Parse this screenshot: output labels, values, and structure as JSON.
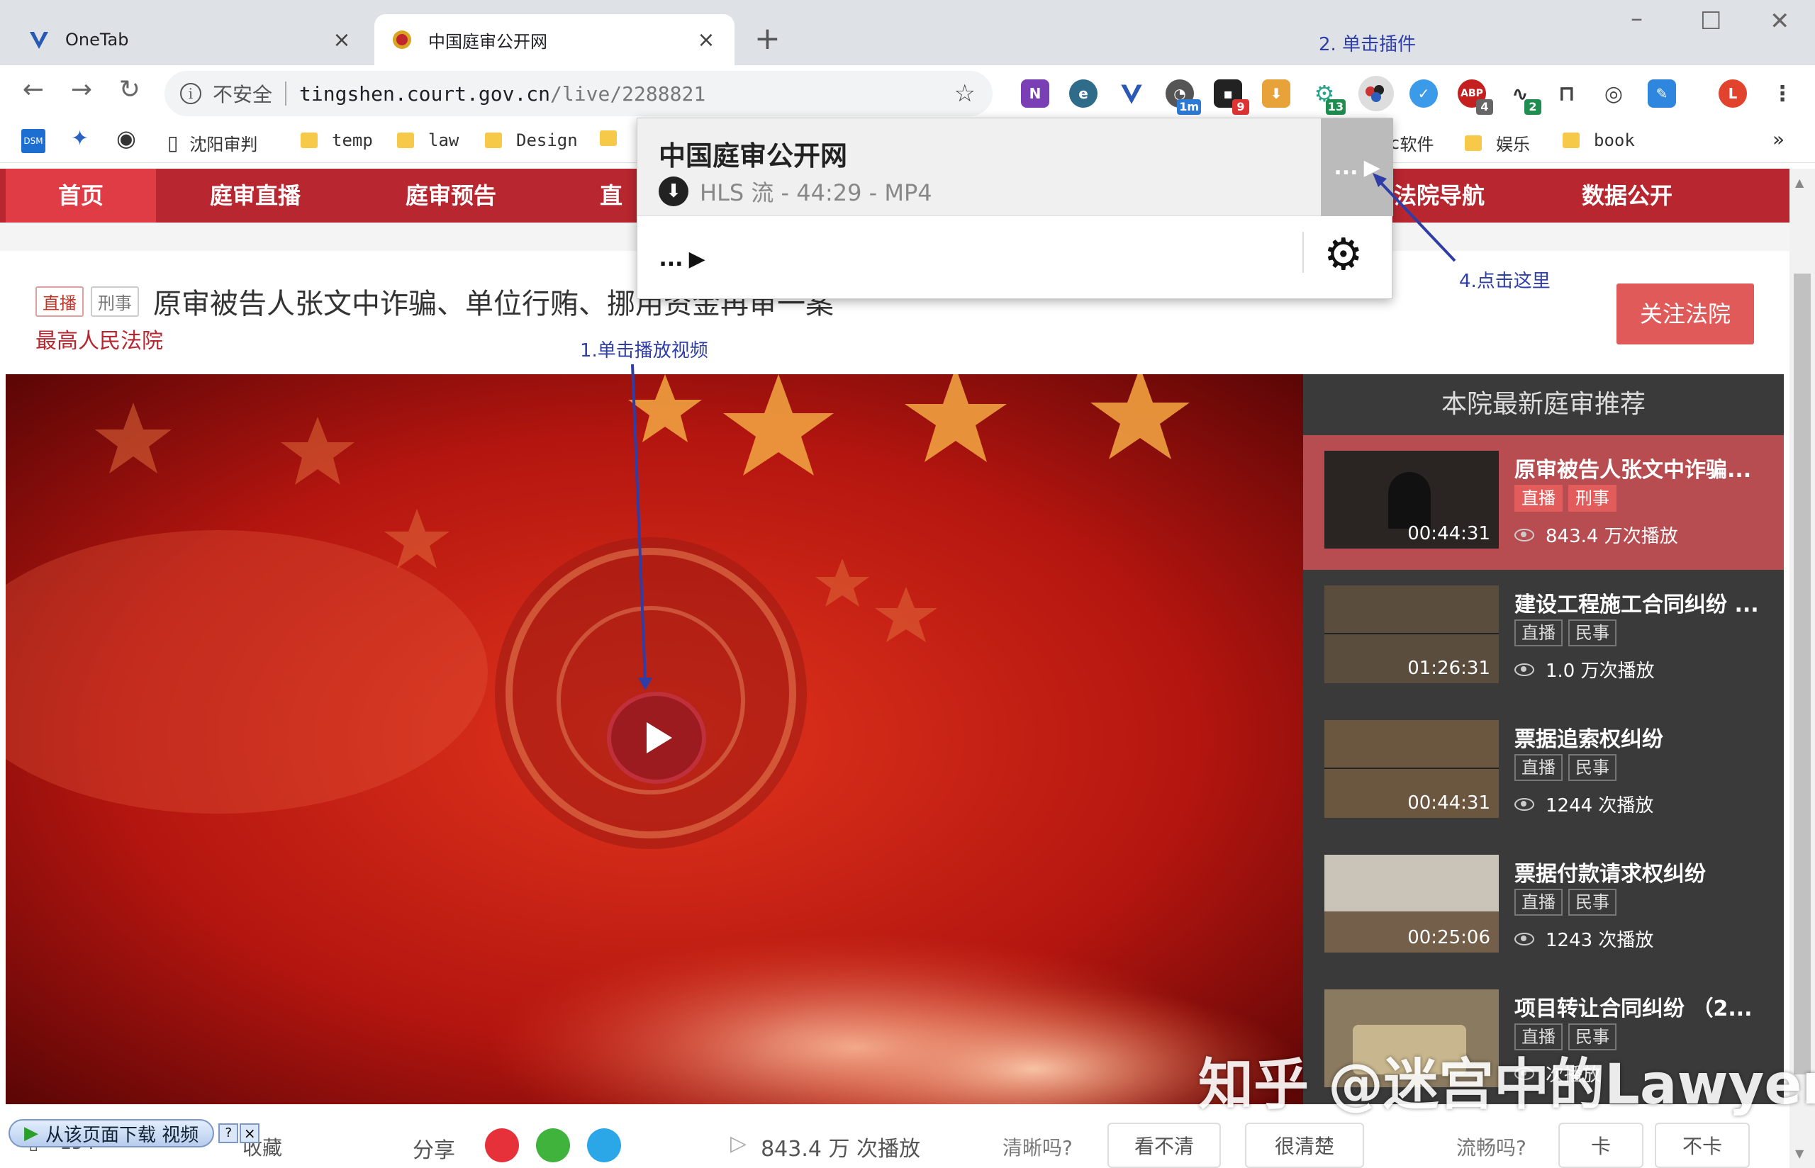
{
  "browser": {
    "tabs": [
      {
        "title": "OneTab",
        "icon": "onetab-icon"
      },
      {
        "title": "中国庭审公开网",
        "icon": "court-emblem-icon"
      }
    ],
    "url": {
      "security": "不安全",
      "host": "tingshen.court.gov.cn",
      "path": "/live/2288821"
    },
    "extensions": [
      {
        "name": "onenote-extension",
        "badge": ""
      },
      {
        "name": "extension-e",
        "badge": ""
      },
      {
        "name": "onetab-extension",
        "badge": ""
      },
      {
        "name": "extension-clock",
        "badge": "1m"
      },
      {
        "name": "extension-dark",
        "badge": "9"
      },
      {
        "name": "extension-download",
        "badge": ""
      },
      {
        "name": "extension-gear",
        "badge": "13"
      },
      {
        "name": "video-downloader-extension",
        "badge": ""
      },
      {
        "name": "extension-check",
        "badge": ""
      },
      {
        "name": "adblock-extension",
        "badge": "4"
      },
      {
        "name": "extension-pulse",
        "badge": "2"
      },
      {
        "name": "extension-bookmark",
        "badge": ""
      },
      {
        "name": "extension-bulb",
        "badge": ""
      },
      {
        "name": "extension-blue",
        "badge": ""
      }
    ],
    "avatar_letter": "L",
    "bookmarks": [
      "沈阳审判",
      "temp",
      "law",
      "Design",
      "软件",
      "娱乐",
      "book"
    ],
    "bookmarks_more": "»"
  },
  "site": {
    "nav": [
      "首页",
      "庭审直播",
      "庭审预告",
      "直播",
      "法院导航",
      "数据公开"
    ],
    "case": {
      "tag_live": "直播",
      "tag_type": "刑事",
      "title": "原审被告人张文中诈骗、单位行贿、挪用资金再审一案",
      "court": "最高人民法院"
    },
    "follow_label": "关注法院",
    "sidebar": {
      "title": "本院最新庭审推荐",
      "items": [
        {
          "title": "原审被告人张文中诈骗...",
          "tags": [
            "直播",
            "刑事"
          ],
          "views": "843.4 万次播放",
          "duration": "00:44:31"
        },
        {
          "title": "建设工程施工合同纠纷 ...",
          "tags": [
            "直播",
            "民事"
          ],
          "views": "1.0 万次播放",
          "duration": "01:26:31"
        },
        {
          "title": "票据追索权纠纷",
          "tags": [
            "直播",
            "民事"
          ],
          "views": "1244 次播放",
          "duration": "00:44:31"
        },
        {
          "title": "票据付款请求权纠纷",
          "tags": [
            "直播",
            "民事"
          ],
          "views": "1243 次播放",
          "duration": "00:25:06"
        },
        {
          "title": "项目转让合同纠纷 （2...",
          "tags": [
            "直播",
            "民事"
          ],
          "views": "次播放",
          "duration": ""
        }
      ]
    },
    "bottom": {
      "likes": "154",
      "collect": "收藏",
      "share": "分享",
      "views": "843.4 万 次播放",
      "clarity_q": "清晰吗?",
      "clarity_a1": "看不清",
      "clarity_a2": "很清楚",
      "smooth_q": "流畅吗?",
      "smooth_a1": "卡",
      "smooth_a2": "不卡"
    }
  },
  "popup": {
    "title": "中国庭审公开网",
    "stream": "HLS 流 - 44:29 - MP4",
    "more": "...",
    "more2": "..."
  },
  "download_bar": {
    "label": "从该页面下载 视频",
    "help": "?",
    "close": "×"
  },
  "annotations": {
    "a1": "1.单击播放视频",
    "a2": "2. 单击插件",
    "a4": "4.点击这里"
  },
  "watermark": "知乎 @迷宫中的Lawyer"
}
